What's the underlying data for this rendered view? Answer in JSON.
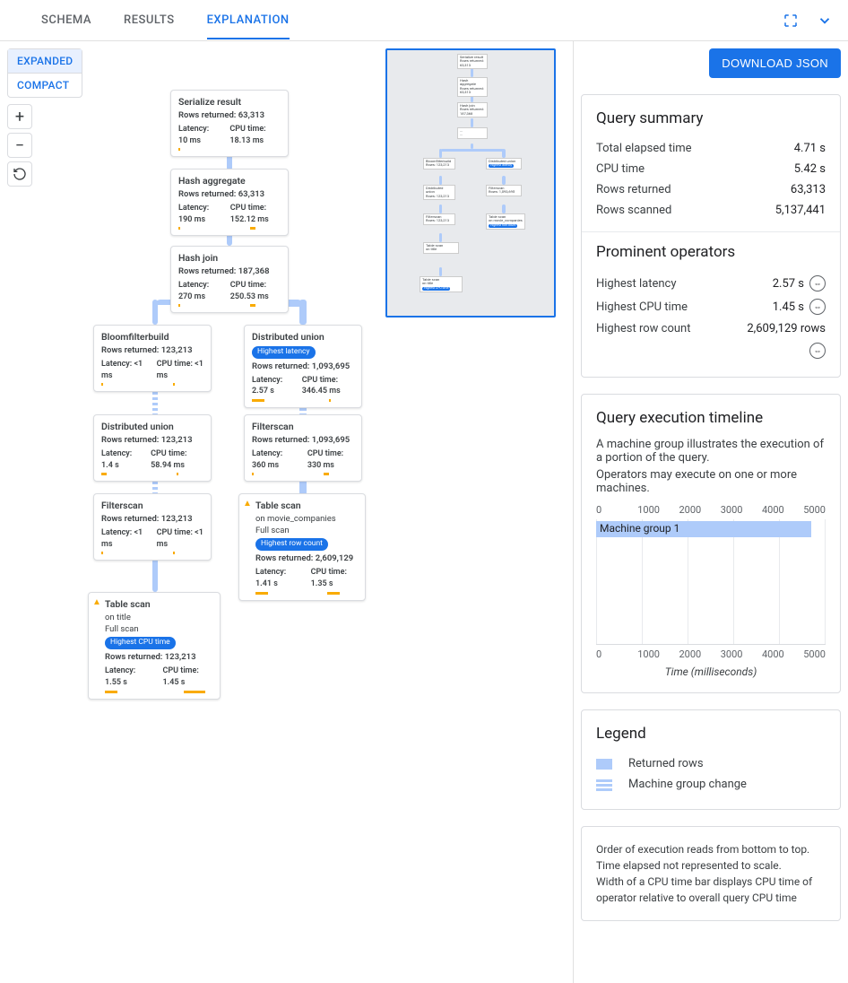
{
  "tabs": [
    "SCHEMA",
    "RESULTS",
    "EXPLANATION"
  ],
  "active_tab": "EXPLANATION",
  "view_toggle": {
    "expanded": "EXPANDED",
    "compact": "COMPACT"
  },
  "download_btn": "DOWNLOAD JSON",
  "nodes": {
    "serialize": {
      "title": "Serialize result",
      "rows": "Rows returned: 63,313",
      "lat": "Latency: 10 ms",
      "cpu": "CPU time: 18.13 ms"
    },
    "hashagg": {
      "title": "Hash aggregate",
      "rows": "Rows returned: 63,313",
      "lat": "Latency: 190 ms",
      "cpu": "CPU time: 152.12 ms"
    },
    "hashjoin": {
      "title": "Hash join",
      "rows": "Rows returned: 187,368",
      "lat": "Latency: 270 ms",
      "cpu": "CPU time: 250.53 ms"
    },
    "bloom": {
      "title": "Bloomfilterbuild",
      "rows": "Rows returned: 123,213",
      "lat": "Latency: <1 ms",
      "cpu": "CPU time: <1 ms"
    },
    "du_right": {
      "title": "Distributed union",
      "badge": "Highest latency",
      "rows": "Rows returned: 1,093,695",
      "lat": "Latency: 2.57 s",
      "cpu": "CPU time: 346.45 ms"
    },
    "du_left": {
      "title": "Distributed union",
      "rows": "Rows returned: 123,213",
      "lat": "Latency: 1.4 s",
      "cpu": "CPU time: 58.94 ms"
    },
    "filter_right": {
      "title": "Filterscan",
      "rows": "Rows returned: 1,093,695",
      "lat": "Latency: 360 ms",
      "cpu": "CPU time: 330 ms"
    },
    "filter_left": {
      "title": "Filterscan",
      "rows": "Rows returned: 123,213",
      "lat": "Latency: <1 ms",
      "cpu": "CPU time: <1 ms"
    },
    "ts_right": {
      "title": "Table scan",
      "on": "on movie_companies",
      "full": "Full scan",
      "badge": "Highest row count",
      "rows": "Rows returned: 2,609,129",
      "lat": "Latency: 1.41 s",
      "cpu": "CPU time: 1.35 s"
    },
    "ts_left": {
      "title": "Table scan",
      "on": "on title",
      "full": "Full scan",
      "badge": "Highest CPU time",
      "rows": "Rows returned: 123,213",
      "lat": "Latency: 1.55 s",
      "cpu": "CPU time: 1.45 s"
    }
  },
  "summary": {
    "title": "Query summary",
    "items": [
      {
        "k": "Total elapsed time",
        "v": "4.71 s"
      },
      {
        "k": "CPU time",
        "v": "5.42 s"
      },
      {
        "k": "Rows returned",
        "v": "63,313"
      },
      {
        "k": "Rows scanned",
        "v": "5,137,441"
      }
    ]
  },
  "prominent": {
    "title": "Prominent operators",
    "items": [
      {
        "k": "Highest latency",
        "v": "2.57 s",
        "link": true
      },
      {
        "k": "Highest CPU time",
        "v": "1.45 s",
        "link": true
      },
      {
        "k": "Highest row count",
        "v": "2,609,129 rows",
        "link": true
      }
    ]
  },
  "timeline": {
    "title": "Query execution timeline",
    "desc1": "A machine group illustrates the execution of a portion of the query.",
    "desc2": "Operators may execute on one or more machines.",
    "ticks": [
      "0",
      "1000",
      "2000",
      "3000",
      "4000",
      "5000"
    ],
    "bar_label": "Machine group 1",
    "axis_label": "Time (milliseconds)"
  },
  "legend": {
    "title": "Legend",
    "returned": "Returned rows",
    "machine": "Machine group change"
  },
  "footnote": {
    "l1": "Order of execution reads from bottom to top.",
    "l2": "Time elapsed not represented to scale.",
    "l3": "Width of a CPU time bar displays CPU time of operator relative to overall query CPU time"
  },
  "chart_data": {
    "type": "bar",
    "categories": [
      "Machine group 1"
    ],
    "values": [
      4710
    ],
    "xlabel": "Time (milliseconds)",
    "ylabel": "",
    "xlim": [
      0,
      5000
    ],
    "title": "Query execution timeline"
  }
}
